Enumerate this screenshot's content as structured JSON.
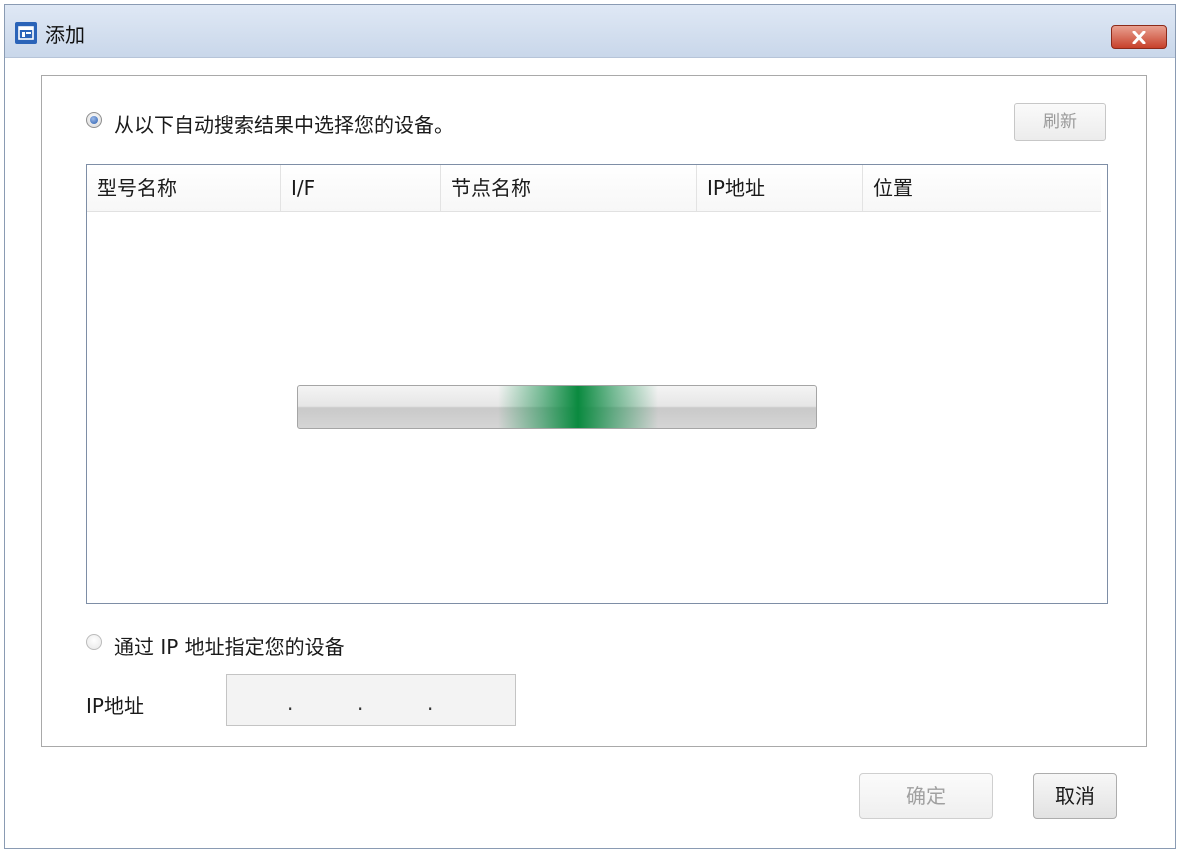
{
  "window": {
    "title": "添加",
    "close_label": "×"
  },
  "auto_search": {
    "option_label": "从以下自动搜索结果中选择您的设备。",
    "selected": true,
    "refresh_label": "刷新",
    "columns": [
      "型号名称",
      "I/F",
      "节点名称",
      "IP地址",
      "位置"
    ],
    "rows": [],
    "searching": true
  },
  "manual": {
    "option_label": "通过 IP 地址指定您的设备",
    "selected": false,
    "ip_label": "IP地址",
    "ip_separators": [
      ".",
      ".",
      "."
    ]
  },
  "footer": {
    "ok_label": "确定",
    "cancel_label": "取消"
  },
  "colors": {
    "title_bar": "#c9d7ea",
    "progress_accent": "#0a8a3f",
    "close_button": "#c7412b"
  }
}
